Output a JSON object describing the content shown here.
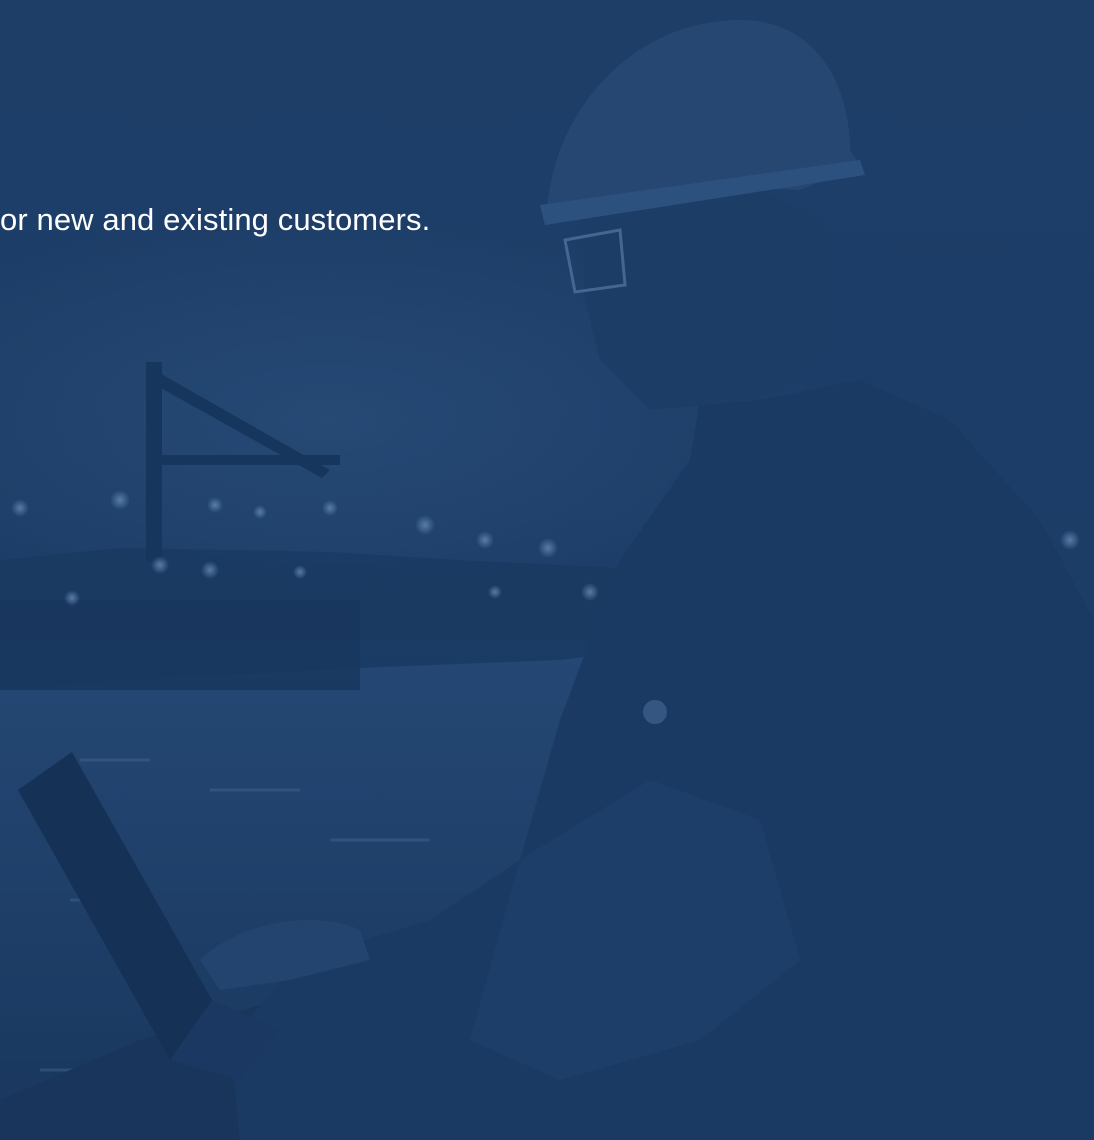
{
  "hero": {
    "text": "or new and existing customers.",
    "background_color": "#1d3d66",
    "text_color": "#ffffff"
  }
}
